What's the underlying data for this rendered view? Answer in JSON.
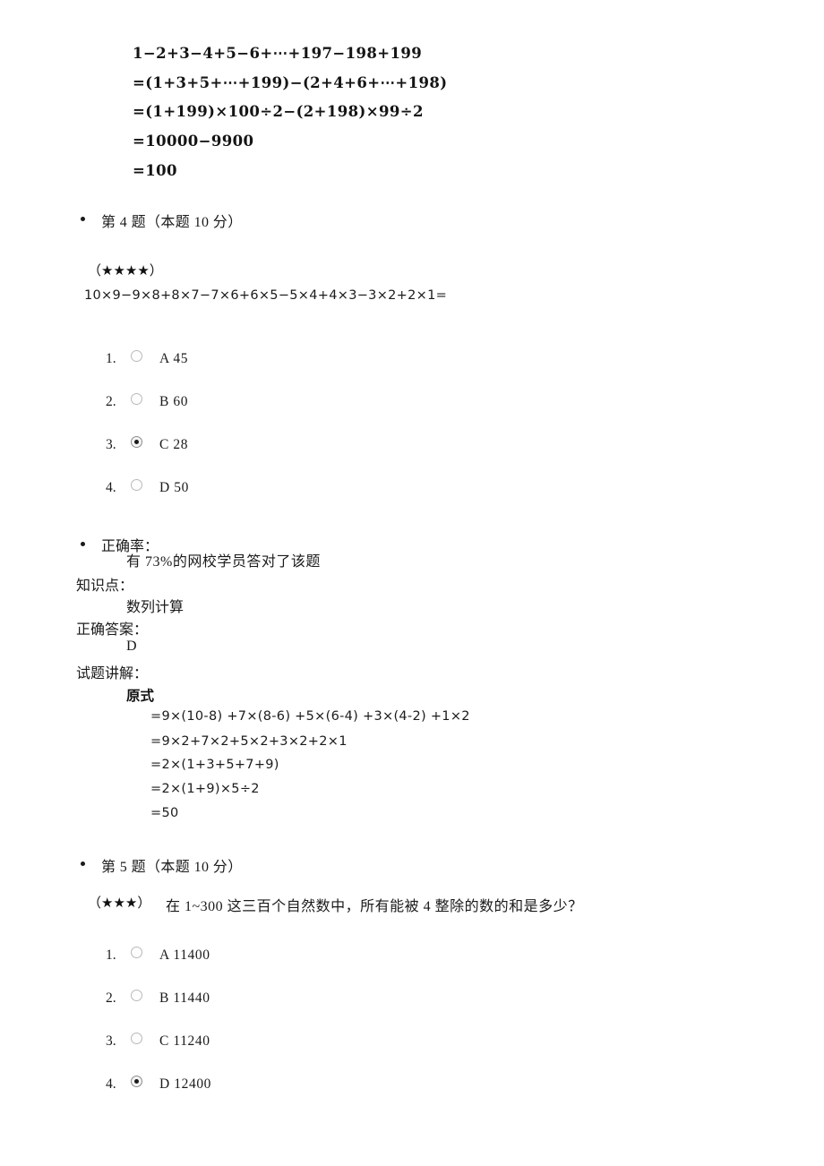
{
  "document": {
    "solution_block_prev": {
      "lines": [
        "1−2+3−4+5−6+⋯+197−198+199",
        "=(1+3+5+⋯+199)−(2+4+6+⋯+198)",
        "=(1+199)×100÷2−(2+198)×99÷2",
        "=10000−9900",
        "=100"
      ]
    },
    "questions": [
      {
        "header": "第 4 题（本题 10 分）",
        "header_number": "4",
        "difficulty_stars": 4,
        "difficulty_text": "（★★★★）",
        "stem": "10×9−9×8+8×7−7×6+6×5−5×4+4×3−3×2+2×1=",
        "options": [
          {
            "index": "1.",
            "letter": "A",
            "value": "45",
            "label": "A  45",
            "selected": false
          },
          {
            "index": "2.",
            "letter": "B",
            "value": "60",
            "label": "B  60",
            "selected": false
          },
          {
            "index": "3.",
            "letter": "C",
            "value": "28",
            "label": "C  28",
            "selected": true
          },
          {
            "index": "4.",
            "letter": "D",
            "value": "50",
            "label": "D  50",
            "selected": false
          }
        ],
        "accuracy_label": "正确率：",
        "accuracy_text": "有 73%的网校学员答对了该题",
        "accuracy_percent": "73%",
        "knowledge_label": "知识点：",
        "knowledge_value": "数列计算",
        "answer_label": "正确答案：",
        "answer_value": "D",
        "explanation_label": "试题讲解：",
        "explanation_title": "原式",
        "explanation_lines": [
          "=9×(10-8) +7×(8-6) +5×(6-4) +3×(4-2) +1×2",
          "=9×2+7×2+5×2+3×2+2×1",
          "=2×(1+3+5+7+9)",
          "=2×(1+9)×5÷2",
          "=50"
        ]
      },
      {
        "header": "第 5 题（本题 10 分）",
        "header_number": "5",
        "difficulty_stars": 3,
        "difficulty_text": "（★★★）",
        "stem": "在 1~300 这三百个自然数中，所有能被 4 整除的数的和是多少？",
        "options": [
          {
            "index": "1.",
            "letter": "A",
            "value": "11400",
            "label": "A  11400",
            "selected": false
          },
          {
            "index": "2.",
            "letter": "B",
            "value": "11440",
            "label": "B  11440",
            "selected": false
          },
          {
            "index": "3.",
            "letter": "C",
            "value": "11240",
            "label": "C  11240",
            "selected": false
          },
          {
            "index": "4.",
            "letter": "D",
            "value": "12400",
            "label": "D  12400",
            "selected": true
          }
        ]
      }
    ]
  }
}
